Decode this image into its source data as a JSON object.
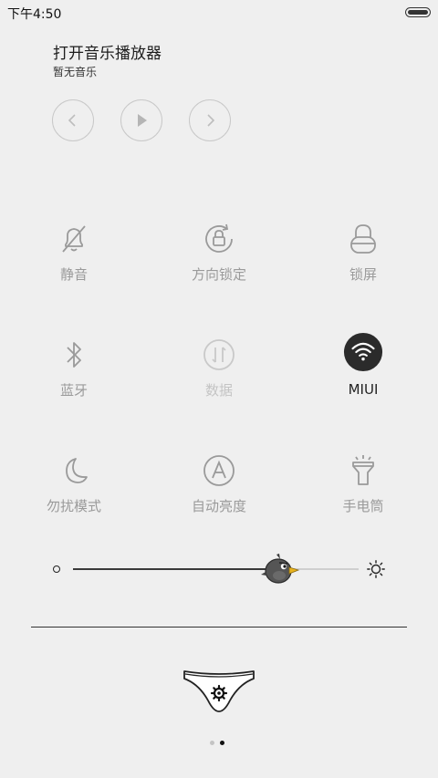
{
  "status_bar": {
    "time": "下午4:50"
  },
  "music": {
    "title": "打开音乐播放器",
    "subtitle": "暂无音乐"
  },
  "toggles": {
    "mute": {
      "label": "静音",
      "icon": "bell-off-icon",
      "active": false
    },
    "rotation_lock": {
      "label": "方向锁定",
      "icon": "rotation-lock-icon",
      "active": false
    },
    "screen_lock": {
      "label": "锁屏",
      "icon": "lock-icon",
      "active": false
    },
    "bluetooth": {
      "label": "蓝牙",
      "icon": "bluetooth-icon",
      "active": false
    },
    "data": {
      "label": "数据",
      "icon": "data-arrows-icon",
      "active": false,
      "disabled": true
    },
    "wifi": {
      "label": "MIUI",
      "icon": "wifi-icon",
      "active": true
    },
    "dnd": {
      "label": "勿扰模式",
      "icon": "moon-icon",
      "active": false
    },
    "auto_brightness": {
      "label": "自动亮度",
      "icon": "auto-a-icon",
      "active": false
    },
    "flashlight": {
      "label": "手电筒",
      "icon": "flashlight-icon",
      "active": false
    }
  },
  "brightness": {
    "level": 0.75
  },
  "pagination": {
    "current": 2,
    "total": 2
  },
  "colors": {
    "background": "#efefef",
    "active_icon_bg": "#2b2b2b",
    "inactive": "#9a9a9a",
    "text_dark": "#222222"
  }
}
